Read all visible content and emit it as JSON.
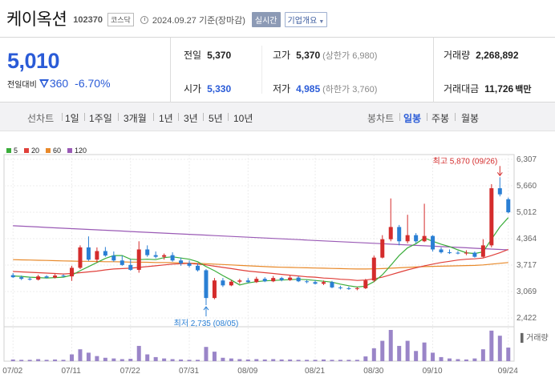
{
  "header": {
    "name": "케이옥션",
    "code": "102370",
    "market": "코스닥",
    "base_date": "2024.09.27 기준(장마감)",
    "realtime_label": "실시간",
    "company_label": "기업개요"
  },
  "quote": {
    "price": "5,010",
    "change_label": "전일대비",
    "change_amount": "360",
    "change_rate": "-6.70%",
    "prev_label": "전일",
    "prev_value": "5,370",
    "open_label": "시가",
    "open_value": "5,330",
    "high_label": "고가",
    "high_value": "5,370",
    "high_limit": "(상한가 6,980)",
    "low_label": "저가",
    "low_value": "4,985",
    "low_limit": "(하한가 3,760)",
    "volume_label": "거래량",
    "volume_value": "2,268,892",
    "amount_label": "거래대금",
    "amount_value": "11,726",
    "amount_unit": "백만"
  },
  "tabs": {
    "line_label": "선차트",
    "line": [
      "1일",
      "1주일",
      "3개월",
      "1년",
      "3년",
      "5년",
      "10년"
    ],
    "candle_label": "봉차트",
    "candle": [
      "일봉",
      "주봉",
      "월봉"
    ],
    "active": "일봉"
  },
  "colors": {
    "up": "#d42c2c",
    "down": "#2a7fd4",
    "ma5": "#3aad3a",
    "ma20": "#e0403a",
    "ma60": "#e8892a",
    "ma120": "#9a5ab5",
    "volume": "#9a85c8"
  },
  "chart_data": {
    "type": "candlestick",
    "legend": [
      {
        "name": "5",
        "color": "#3aad3a"
      },
      {
        "name": "20",
        "color": "#e0403a"
      },
      {
        "name": "60",
        "color": "#e8892a"
      },
      {
        "name": "120",
        "color": "#9a5ab5"
      }
    ],
    "y_ticks": [
      "6,307",
      "5,660",
      "5,012",
      "4,364",
      "3,717",
      "3,069",
      "2,422"
    ],
    "y_tick_values": [
      6307,
      5660,
      5012,
      4364,
      3717,
      3069,
      2422
    ],
    "ylim": [
      2422,
      6307
    ],
    "x_ticks": [
      "07/02",
      "07/11",
      "07/22",
      "07/31",
      "08/09",
      "08/21",
      "08/30",
      "09/10",
      "09/24"
    ],
    "x_tick_index": [
      0,
      7,
      14,
      21,
      28,
      36,
      43,
      50,
      59
    ],
    "volume_label": "거래량",
    "max_annotation": "최고 5,870 (09/26)",
    "min_annotation": "최저 2,735 (08/05)",
    "candles": [
      {
        "o": 3470,
        "h": 3520,
        "l": 3400,
        "c": 3420
      },
      {
        "o": 3420,
        "h": 3460,
        "l": 3350,
        "c": 3380
      },
      {
        "o": 3380,
        "h": 3430,
        "l": 3340,
        "c": 3360
      },
      {
        "o": 3360,
        "h": 3480,
        "l": 3340,
        "c": 3440
      },
      {
        "o": 3440,
        "h": 3470,
        "l": 3390,
        "c": 3410
      },
      {
        "o": 3410,
        "h": 3500,
        "l": 3390,
        "c": 3460
      },
      {
        "o": 3460,
        "h": 3490,
        "l": 3420,
        "c": 3440
      },
      {
        "o": 3440,
        "h": 3700,
        "l": 3330,
        "c": 3650
      },
      {
        "o": 3650,
        "h": 4200,
        "l": 3620,
        "c": 4150
      },
      {
        "o": 4150,
        "h": 4420,
        "l": 3820,
        "c": 3850
      },
      {
        "o": 3850,
        "h": 4150,
        "l": 3780,
        "c": 4060
      },
      {
        "o": 4060,
        "h": 4160,
        "l": 3920,
        "c": 3950
      },
      {
        "o": 3950,
        "h": 4050,
        "l": 3800,
        "c": 3830
      },
      {
        "o": 3830,
        "h": 3950,
        "l": 3700,
        "c": 3720
      },
      {
        "o": 3720,
        "h": 3860,
        "l": 3580,
        "c": 3600
      },
      {
        "o": 3600,
        "h": 4300,
        "l": 3530,
        "c": 4100
      },
      {
        "o": 4100,
        "h": 4200,
        "l": 3920,
        "c": 3960
      },
      {
        "o": 3960,
        "h": 4050,
        "l": 3880,
        "c": 3920
      },
      {
        "o": 3920,
        "h": 4000,
        "l": 3850,
        "c": 3960
      },
      {
        "o": 3960,
        "h": 4030,
        "l": 3800,
        "c": 3830
      },
      {
        "o": 3830,
        "h": 3900,
        "l": 3700,
        "c": 3760
      },
      {
        "o": 3760,
        "h": 3830,
        "l": 3660,
        "c": 3700
      },
      {
        "o": 3700,
        "h": 3760,
        "l": 3560,
        "c": 3590
      },
      {
        "o": 3590,
        "h": 3620,
        "l": 2735,
        "c": 2910
      },
      {
        "o": 2910,
        "h": 3400,
        "l": 2880,
        "c": 3340
      },
      {
        "o": 3340,
        "h": 3400,
        "l": 3180,
        "c": 3220
      },
      {
        "o": 3220,
        "h": 3350,
        "l": 3200,
        "c": 3310
      },
      {
        "o": 3310,
        "h": 3380,
        "l": 3260,
        "c": 3340
      },
      {
        "o": 3340,
        "h": 3400,
        "l": 3280,
        "c": 3300
      },
      {
        "o": 3300,
        "h": 3430,
        "l": 3280,
        "c": 3380
      },
      {
        "o": 3380,
        "h": 3420,
        "l": 3300,
        "c": 3320
      },
      {
        "o": 3320,
        "h": 3450,
        "l": 3300,
        "c": 3400
      },
      {
        "o": 3400,
        "h": 3430,
        "l": 3320,
        "c": 3350
      },
      {
        "o": 3350,
        "h": 3460,
        "l": 3330,
        "c": 3410
      },
      {
        "o": 3410,
        "h": 3440,
        "l": 3300,
        "c": 3320
      },
      {
        "o": 3320,
        "h": 3350,
        "l": 3270,
        "c": 3300
      },
      {
        "o": 3300,
        "h": 3350,
        "l": 3240,
        "c": 3260
      },
      {
        "o": 3260,
        "h": 3340,
        "l": 3230,
        "c": 3300
      },
      {
        "o": 3300,
        "h": 3330,
        "l": 3150,
        "c": 3170
      },
      {
        "o": 3170,
        "h": 3210,
        "l": 3120,
        "c": 3150
      },
      {
        "o": 3150,
        "h": 3190,
        "l": 3110,
        "c": 3130
      },
      {
        "o": 3130,
        "h": 3180,
        "l": 3100,
        "c": 3150
      },
      {
        "o": 3150,
        "h": 3380,
        "l": 3130,
        "c": 3340
      },
      {
        "o": 3340,
        "h": 3950,
        "l": 3300,
        "c": 3900
      },
      {
        "o": 3900,
        "h": 4450,
        "l": 3880,
        "c": 4350
      },
      {
        "o": 4350,
        "h": 5350,
        "l": 4300,
        "c": 4650
      },
      {
        "o": 4650,
        "h": 4700,
        "l": 4200,
        "c": 4300
      },
      {
        "o": 4300,
        "h": 4950,
        "l": 4250,
        "c": 4450
      },
      {
        "o": 4450,
        "h": 4500,
        "l": 4250,
        "c": 4300
      },
      {
        "o": 4300,
        "h": 5220,
        "l": 4280,
        "c": 4430
      },
      {
        "o": 4430,
        "h": 4450,
        "l": 4050,
        "c": 4100
      },
      {
        "o": 4100,
        "h": 4150,
        "l": 4000,
        "c": 4030
      },
      {
        "o": 4030,
        "h": 4100,
        "l": 3990,
        "c": 4020
      },
      {
        "o": 4020,
        "h": 4060,
        "l": 3980,
        "c": 4000
      },
      {
        "o": 4000,
        "h": 4080,
        "l": 3960,
        "c": 4020
      },
      {
        "o": 4020,
        "h": 4050,
        "l": 3900,
        "c": 3920
      },
      {
        "o": 3920,
        "h": 4350,
        "l": 3900,
        "c": 4200
      },
      {
        "o": 4200,
        "h": 5700,
        "l": 4150,
        "c": 5600
      },
      {
        "o": 5600,
        "h": 5870,
        "l": 5400,
        "c": 5450
      },
      {
        "o": 5330,
        "h": 5370,
        "l": 4985,
        "c": 5010
      }
    ],
    "volume_values": [
      0.05,
      0.04,
      0.04,
      0.06,
      0.04,
      0.05,
      0.04,
      0.2,
      0.35,
      0.25,
      0.15,
      0.1,
      0.08,
      0.06,
      0.07,
      0.45,
      0.2,
      0.12,
      0.08,
      0.06,
      0.05,
      0.04,
      0.04,
      0.42,
      0.28,
      0.1,
      0.08,
      0.06,
      0.05,
      0.06,
      0.05,
      0.06,
      0.05,
      0.05,
      0.04,
      0.04,
      0.04,
      0.05,
      0.04,
      0.04,
      0.04,
      0.04,
      0.14,
      0.38,
      0.6,
      0.92,
      0.45,
      0.6,
      0.3,
      0.55,
      0.25,
      0.12,
      0.08,
      0.06,
      0.05,
      0.08,
      0.35,
      0.9,
      0.75,
      0.4
    ],
    "ma5": [
      3450,
      3440,
      3420,
      3410,
      3400,
      3410,
      3420,
      3470,
      3580,
      3680,
      3780,
      3880,
      3950,
      3950,
      3860,
      3850,
      3860,
      3850,
      3900,
      3920,
      3890,
      3860,
      3800,
      3680,
      3580,
      3460,
      3350,
      3230,
      3280,
      3310,
      3330,
      3340,
      3350,
      3360,
      3370,
      3360,
      3340,
      3320,
      3300,
      3250,
      3210,
      3180,
      3200,
      3310,
      3480,
      3710,
      3950,
      4140,
      4240,
      4380,
      4300,
      4230,
      4170,
      4090,
      4020,
      4000,
      4040,
      4350,
      4650,
      4880
    ],
    "ma20": [
      3560,
      3550,
      3540,
      3530,
      3520,
      3510,
      3500,
      3510,
      3530,
      3550,
      3570,
      3600,
      3620,
      3630,
      3640,
      3660,
      3680,
      3700,
      3720,
      3740,
      3750,
      3760,
      3740,
      3720,
      3690,
      3660,
      3630,
      3600,
      3570,
      3550,
      3530,
      3510,
      3490,
      3470,
      3450,
      3430,
      3420,
      3400,
      3390,
      3370,
      3360,
      3340,
      3350,
      3380,
      3420,
      3480,
      3540,
      3600,
      3650,
      3700,
      3740,
      3780,
      3810,
      3840,
      3860,
      3870,
      3890,
      3950,
      4020,
      4100
    ],
    "ma60": [
      3850,
      3845,
      3840,
      3835,
      3830,
      3825,
      3820,
      3815,
      3810,
      3810,
      3805,
      3800,
      3800,
      3795,
      3790,
      3790,
      3785,
      3780,
      3780,
      3775,
      3770,
      3765,
      3760,
      3750,
      3740,
      3730,
      3720,
      3710,
      3700,
      3690,
      3680,
      3670,
      3665,
      3660,
      3655,
      3650,
      3645,
      3640,
      3635,
      3630,
      3625,
      3620,
      3620,
      3625,
      3630,
      3640,
      3650,
      3660,
      3670,
      3680,
      3685,
      3690,
      3695,
      3700,
      3705,
      3710,
      3720,
      3740,
      3760,
      3780
    ],
    "ma120": [
      4680,
      4670,
      4660,
      4650,
      4640,
      4630,
      4620,
      4610,
      4600,
      4590,
      4580,
      4570,
      4560,
      4550,
      4540,
      4530,
      4520,
      4510,
      4500,
      4490,
      4480,
      4470,
      4460,
      4450,
      4440,
      4430,
      4420,
      4410,
      4400,
      4390,
      4380,
      4370,
      4360,
      4350,
      4340,
      4330,
      4320,
      4310,
      4300,
      4290,
      4280,
      4270,
      4260,
      4250,
      4240,
      4230,
      4220,
      4210,
      4200,
      4190,
      4180,
      4170,
      4160,
      4150,
      4140,
      4130,
      4120,
      4110,
      4100,
      4090
    ]
  }
}
